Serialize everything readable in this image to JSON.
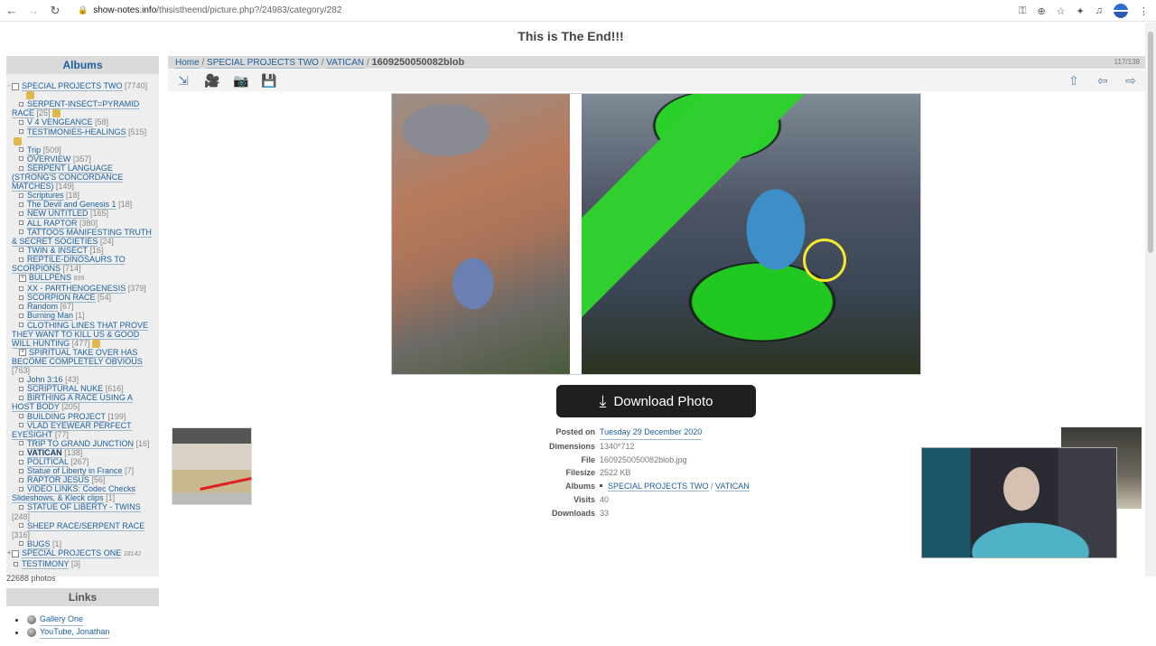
{
  "browser": {
    "url_host": "show-notes.info",
    "url_path": "/thisistheend/picture.php?/24983/category/282",
    "icons": [
      "back-icon",
      "forward-icon",
      "reload-icon",
      "lock-icon",
      "key-icon",
      "zoom-icon",
      "star-icon",
      "extensions-icon",
      "media-icon",
      "profile-avatar",
      "menu-icon"
    ]
  },
  "site": {
    "title": "This is The End!!!"
  },
  "sidebar": {
    "albums_heading": "Albums",
    "tree": [
      {
        "label": "SPECIAL PROJECTS TWO",
        "count": "[7740]",
        "level": 1,
        "expand": "-",
        "badge": true
      },
      {
        "label": "SERPENT-INSECT=PYRAMID RACE",
        "count": "[25]",
        "level": 2,
        "badge": true
      },
      {
        "label": "V 4 VENGEANCE",
        "count": "[58]",
        "level": 2
      },
      {
        "label": "TESTIMONIES-HEALINGS",
        "count": "[515]",
        "level": 2,
        "badge": true
      },
      {
        "label": "Trip",
        "count": "[509]",
        "level": 2
      },
      {
        "label": "OVERVIEW",
        "count": "[357]",
        "level": 2
      },
      {
        "label": "SERPENT LANGUAGE (STRONG'S CONCORDANCE MATCHES)",
        "count": "[149]",
        "level": 2
      },
      {
        "label": "Scriptures",
        "count": "[18]",
        "level": 2
      },
      {
        "label": "The Devil and Genesis 1",
        "count": "[18]",
        "level": 2
      },
      {
        "label": "NEW UNTITLED",
        "count": "[165]",
        "level": 2
      },
      {
        "label": "ALL RAPTOR",
        "count": "[380]",
        "level": 2
      },
      {
        "label": "TATTOOS MANIFESTING TRUTH & SECRET SOCIETIES",
        "count": "[24]",
        "level": 2
      },
      {
        "label": "TWIN & INSECT",
        "count": "[16]",
        "level": 2
      },
      {
        "label": "REPTILE-DINOSAURS TO SCORPIONS",
        "count": "[714]",
        "level": 2
      },
      {
        "label": "BULLPENS",
        "count": "899",
        "level": 2,
        "expand": "+",
        "italic": true
      },
      {
        "label": "XX - PARTHENOGENESIS",
        "count": "[379]",
        "level": 2
      },
      {
        "label": "SCORPION RACE",
        "count": "[54]",
        "level": 2
      },
      {
        "label": "Random",
        "count": "[67]",
        "level": 2
      },
      {
        "label": "Burning Man",
        "count": "[1]",
        "level": 2
      },
      {
        "label": "CLOTHING LINES THAT PROVE THEY WANT TO KILL US & GOOD WILL HUNTING",
        "count": "[477]",
        "level": 2,
        "badge": true
      },
      {
        "label": "SPIRITUAL TAKE OVER HAS BECOME COMPLETELY OBVIOUS",
        "count": "[763]",
        "level": 2,
        "expand": "+"
      },
      {
        "label": "John 3:16",
        "count": "[43]",
        "level": 2
      },
      {
        "label": "SCRIPTURAL NUKE",
        "count": "[616]",
        "level": 2
      },
      {
        "label": "BIRTHING A RACE USING A HOST BODY",
        "count": "[205]",
        "level": 2
      },
      {
        "label": "BUILDING PROJECT",
        "count": "[199]",
        "level": 2
      },
      {
        "label": "VLAD EYEWEAR PERFECT EYESIGHT",
        "count": "[77]",
        "level": 2
      },
      {
        "label": "TRIP TO GRAND JUNCTION",
        "count": "[16]",
        "level": 2
      },
      {
        "label": "VATICAN",
        "count": "[138]",
        "level": 2,
        "current": true
      },
      {
        "label": "POLITICAL",
        "count": "[267]",
        "level": 2
      },
      {
        "label": "Statue of Liberty in France",
        "count": "[7]",
        "level": 2
      },
      {
        "label": "RAPTOR JESUS",
        "count": "[56]",
        "level": 2
      },
      {
        "label": "VIDEO LINKS: Codec Checks Slideshows, & Kleck clips",
        "count": "[1]",
        "level": 2
      },
      {
        "label": "STATUE OF LIBERTY - TWINS",
        "count": "[248]",
        "level": 2
      },
      {
        "label": "SHEEP RACE/SERPENT RACE",
        "count": "[316]",
        "level": 2
      },
      {
        "label": "BUGS",
        "count": "[1]",
        "level": 2
      },
      {
        "label": "SPECIAL PROJECTS ONE",
        "count": "18142",
        "level": 1,
        "expand": "+",
        "italic": true
      },
      {
        "label": "TESTIMONY",
        "count": "[3]",
        "level": 1
      }
    ],
    "photos_count": "22688 photos",
    "links_heading": "Links",
    "links": [
      "Gallery One",
      "YouTube, Jonathan"
    ]
  },
  "main": {
    "breadcrumb": {
      "home": "Home",
      "album": "SPECIAL PROJECTS TWO",
      "sub": "VATICAN",
      "current": "1609250050082blob",
      "sep": "/"
    },
    "counter": "117/138",
    "toolbar": [
      "fit-image-icon",
      "slideshow-icon",
      "camera-info-icon",
      "save-icon"
    ],
    "nav": [
      "up-icon",
      "previous-icon",
      "next-icon"
    ],
    "download_label": "Download Photo",
    "info": [
      {
        "key": "Posted on",
        "value": "Tuesday 29 December 2020",
        "link": true
      },
      {
        "key": "Dimensions",
        "value": "1340*712"
      },
      {
        "key": "File",
        "value": "1609250050082blob.jpg"
      },
      {
        "key": "Filesize",
        "value": "2522 KB"
      },
      {
        "key": "Albums",
        "value": "SPECIAL PROJECTS TWO",
        "value2": "VATICAN",
        "link": true
      },
      {
        "key": "Visits",
        "value": "40"
      },
      {
        "key": "Downloads",
        "value": "33"
      }
    ]
  }
}
